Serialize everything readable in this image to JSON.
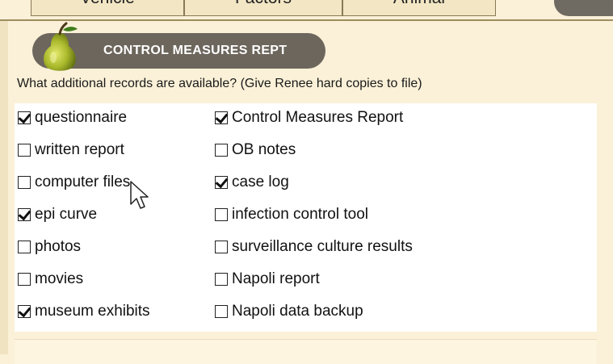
{
  "tabs": [
    {
      "label": "Vehicle"
    },
    {
      "label": "Factors"
    },
    {
      "label": "Animal"
    }
  ],
  "header": {
    "title": "CONTROL MEASURES REPT",
    "icon": "pear-icon"
  },
  "question": "What additional records are available? (Give Renee hard copies to file)",
  "left_items": [
    {
      "label": "questionnaire",
      "checked": true
    },
    {
      "label": "written report",
      "checked": false
    },
    {
      "label": "computer files",
      "checked": false
    },
    {
      "label": "epi curve",
      "checked": true
    },
    {
      "label": "photos",
      "checked": false
    },
    {
      "label": "movies",
      "checked": false
    },
    {
      "label": "museum exhibits",
      "checked": true
    }
  ],
  "right_items": [
    {
      "label": "Control Measures Report",
      "checked": true
    },
    {
      "label": "OB notes",
      "checked": false
    },
    {
      "label": "case log",
      "checked": true
    },
    {
      "label": "infection control tool",
      "checked": false
    },
    {
      "label": "surveillance culture results",
      "checked": false
    },
    {
      "label": "Napoli report",
      "checked": false
    },
    {
      "label": "Napoli data backup",
      "checked": false
    }
  ]
}
